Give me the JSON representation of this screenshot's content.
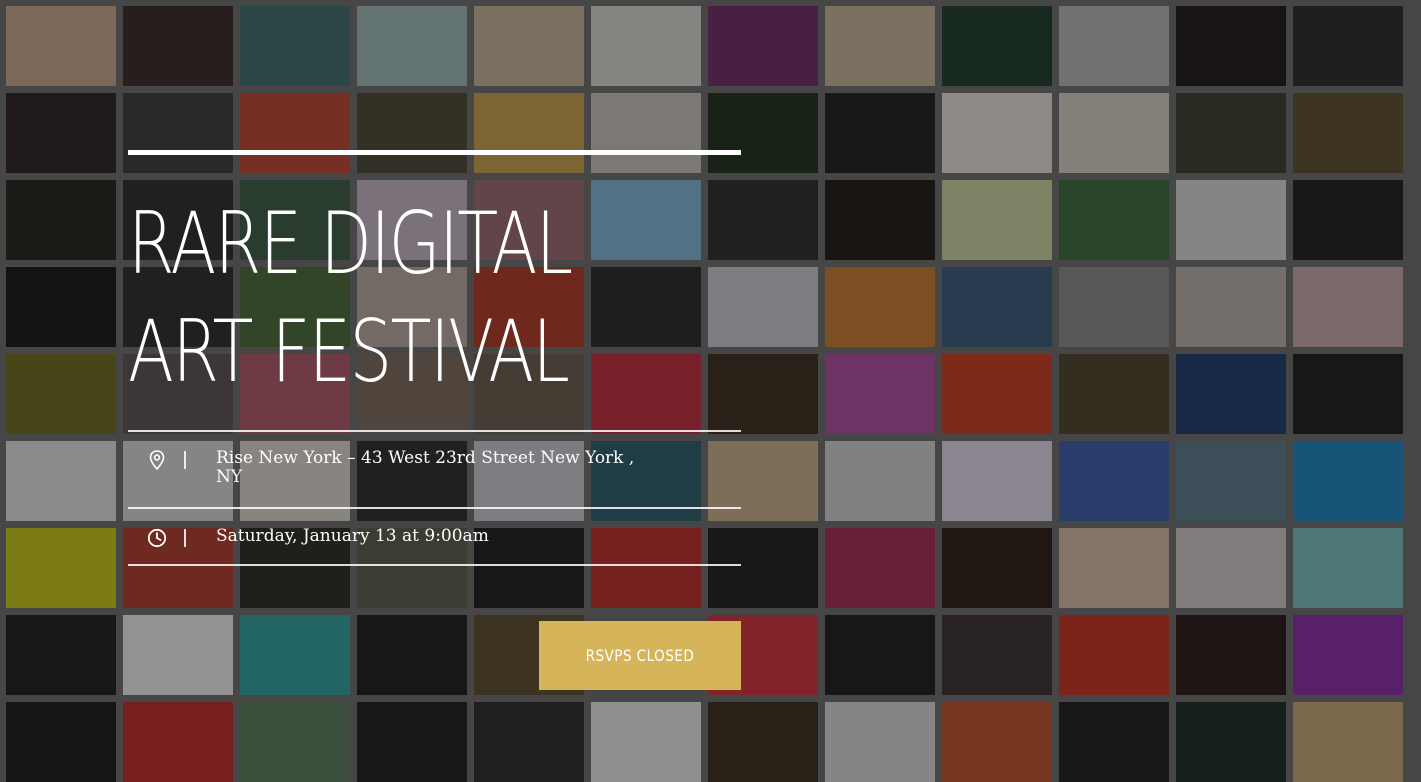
{
  "event": {
    "title_line1": "RARE DIGITAL",
    "title_line2": "ART FESTIVAL",
    "location_icon": "location-pin-icon",
    "location": "Rise New York – 43 West 23rd Street New York , NY",
    "time_icon": "clock-icon",
    "datetime": "Saturday, January 13 at 9:00am",
    "rsvp_label": "RSVPS CLOSED",
    "accent_color": "#d6b45a"
  },
  "mosaic": {
    "tile_colors": [
      "#c9a58c",
      "#3a2626",
      "#3f6d6d",
      "#9ebbb7",
      "#c8b59a",
      "#d8d8d0",
      "#6d2a66",
      "#c9b69a",
      "#1c3a28",
      "#b9b7b9",
      "#1c1518",
      "#2a2828",
      "#2b1f1f",
      "#3a3a3a",
      "#c04230",
      "#4a4633",
      "#c8a04a",
      "#c8c2b8",
      "#1d2d1a",
      "#1c1c1c",
      "#e6e0d8",
      "#d8d0c4",
      "#3a3c2c",
      "#5a4a2a",
      "#20201a",
      "#2a2a2a",
      "#3a5a40",
      "#c4b6c4",
      "#9a6a70",
      "#7fb6d8",
      "#2a2a2a",
      "#1c1814",
      "#c8d4a0",
      "#3a6a3a",
      "#d8d8d8",
      "#1a1a1a",
      "#141418",
      "#2a2a2a",
      "#4a6a3a",
      "#b8a8a0",
      "#b03a24",
      "#262626",
      "#c8c8d0",
      "#c87a30",
      "#3a5a7a",
      "#8a8a8a",
      "#b8b0a8",
      "#c8a8a8",
      "#6a6a1a",
      "#5a5050",
      "#b05868",
      "#7a6a5a",
      "#6a5a4a",
      "#c02a3a",
      "#3a2a1a",
      "#b04aa0",
      "#c83a20",
      "#4a4228",
      "#1a3a6a",
      "#1a1a1a",
      "#e0e0e0",
      "#d8d8d8",
      "#dcd8d0",
      "#2a2a2a",
      "#c8c8d0",
      "#2a5a6a",
      "#c8b08a",
      "#d0d0d0",
      "#e0d8e8",
      "#3a5aaa",
      "#5a7a8a",
      "#1a80c0",
      "#c8c818",
      "#b03a2a",
      "#2a2820",
      "#5a5a4a",
      "#1a1a1a",
      "#c02a2a",
      "#1a1a1a",
      "#a02a50",
      "#2a1a14",
      "#d8b8a8",
      "#d0c8c8",
      "#7ac0c0",
      "#1a1a1a",
      "#f0f0f0",
      "#30a0a0",
      "#1a1a1a",
      "#5a4a2a",
      "#6a6a6a",
      "#d0303a",
      "#1a1a1a",
      "#3a3030",
      "#c83020",
      "#2a1818",
      "#8a2aa8",
      "#1a1818",
      "#c02828",
      "#5a7a5a",
      "#1a1a1a",
      "#2a2a2a",
      "#e8e8e8",
      "#3a2a1a",
      "#d8d8d8",
      "#c0502a",
      "#1a1a1a",
      "#1a2a20",
      "#c8a878"
    ]
  }
}
